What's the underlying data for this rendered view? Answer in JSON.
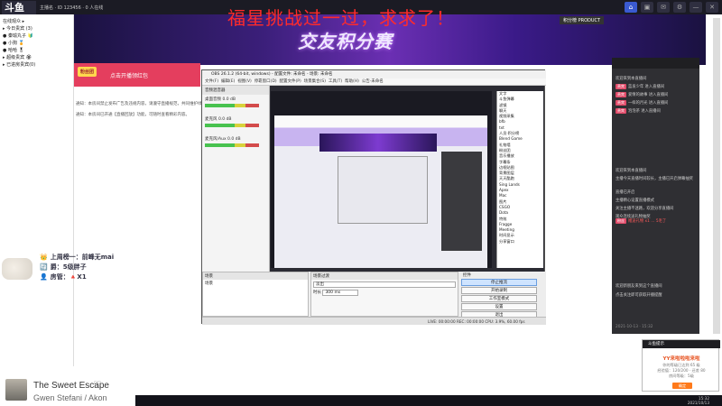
{
  "topbar": {
    "logo": "斗鱼",
    "title": "主播名 · ID 123456 · 0 人在线",
    "buttons": [
      "⌂",
      "▣",
      "✉",
      "⚙",
      "—",
      "✕"
    ]
  },
  "banner": {
    "headline": "福星挑战过一过，求求了！",
    "title": "交友积分赛",
    "badge": "积分榜 PRODUCT"
  },
  "left_tree": {
    "items": [
      "在线观众 ▸",
      "▸ 今日贵宾 (3)",
      "  ● 秦瑜丸子 🔰",
      "  ● 小狗 🏅",
      "  ● 哈哈 🎖",
      "▸ 超级贵宾 🏵",
      "▸ 已进房贵宾(0)"
    ]
  },
  "stream_tag": {
    "badge": "粉丝团",
    "label": "点击开播领红包"
  },
  "notices": [
    "通知：本房间禁止发布广告及违规内容，请遵守直播规范，共同维护绿色直播环境。",
    "通知：本房间已开通【直播回放】功能，可随时查看精彩内容。"
  ],
  "chat_fragment": [
    {
      "icon": "👑",
      "text": "上周榜一：前峰无mai"
    },
    {
      "icon": "🔄",
      "text": "爵：5级胖子"
    },
    {
      "icon": "👤",
      "text": "房管：🔺X1"
    }
  ],
  "obs": {
    "title": "OBS 26.1.2 (64-bit, windows) - 配置文件: 未命名 - 场景: 未命名",
    "menu": [
      "文件(F)",
      "编辑(E)",
      "视图(V)",
      "停靠窗口(D)",
      "配置文件(P)",
      "场景集合(S)",
      "工具(T)",
      "帮助(H)",
      "公告·未命名"
    ],
    "mixer_title": "音频混音器",
    "mixer_rows": [
      {
        "name": "桌面音频",
        "db": "0.0 dB"
      },
      {
        "name": "麦克风",
        "db": "0.0 dB"
      },
      {
        "name": "麦克风/Aux",
        "db": "0.0 dB"
      }
    ],
    "sources": [
      "文字",
      "斗鱼弹幕",
      "滤镜",
      "聊天",
      "视频采集",
      "bfb",
      "txt",
      "人员·积分榜",
      "Blend Game",
      "礼物墙",
      "粉丝团",
      "音乐播放",
      "字幕条",
      "边框贴图",
      "背景图层",
      "天天酷跑",
      "Sing Lands",
      "Apex",
      "Mac",
      "图片",
      "CSGO",
      "Dota",
      "特效",
      "Fragge",
      "Meeting",
      "时间显示",
      "分享窗口"
    ],
    "transitions_title": "场景过渡",
    "transition_value": "淡出",
    "duration_label": "时长",
    "duration_value": "300 ms",
    "scenes_label": "场景",
    "controls_title": "控件",
    "controls": [
      "停止推流",
      "开始录制",
      "工作室模式",
      "设置",
      "退出"
    ],
    "status": "LIVE: 00:00:00   REC: 00:00:00   CPU: 3.9%, 60.00 fps"
  },
  "right_panel": {
    "lines": [
      {
        "tag": "",
        "text": "欢迎来到本直播间",
        "hl": false
      },
      {
        "tag": "贵宾",
        "text": "蓝发少年 进入直播间",
        "hl": false
      },
      {
        "tag": "贵宾",
        "text": "爱情的故事 进入直播间",
        "hl": false
      },
      {
        "tag": "贵宾",
        "text": "一样的月光 进入直播间",
        "hl": false
      },
      {
        "tag": "贵宾",
        "text": "泡泡茶 进入直播间",
        "hl": false
      },
      {
        "tag": "",
        "text": "欢迎来到本直播间",
        "hl": false
      },
      {
        "tag": "",
        "text": "主播今天直播时间较长，主播已开启弹幕抽奖",
        "hl": false
      },
      {
        "tag": "",
        "text": "直播已开启",
        "hl": false
      },
      {
        "tag": "",
        "text": "主播精心设置直播模式",
        "hl": false
      },
      {
        "tag": "",
        "text": "关注主播不迷路，欢迎分享直播间",
        "hl": false
      },
      {
        "tag": "",
        "text": "观众连续送礼物抽奖",
        "hl": false
      },
      {
        "tag": "粉丝",
        "text": "赠送礼物 x1 … 5毛了",
        "hl": true
      },
      {
        "tag": "",
        "text": "欢迎新朋友来到这个直播间",
        "hl": false
      },
      {
        "tag": "",
        "text": "点击关注即可获取开播提醒",
        "hl": false
      }
    ],
    "footer": "2021-10-13 · 15:32"
  },
  "popup": {
    "header": "斗鱼提示",
    "title": "YY来啦啦啦来啦",
    "lines": [
      "你的等级已达到 65 级",
      "经验值：120/200 · 还差 80",
      "房间等级：5级"
    ],
    "button": "确定"
  },
  "player": {
    "song": "The Sweet Escape",
    "artist": "Gwen Stefani / Akon"
  },
  "taskbar": {
    "time": "15:32",
    "date": "2021/10/13"
  }
}
